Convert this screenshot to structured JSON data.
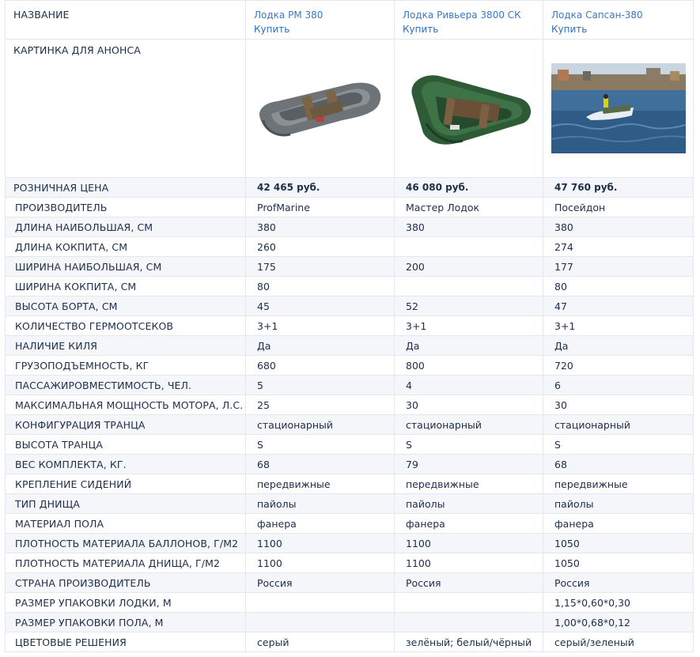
{
  "header_label": "НАЗВАНИЕ",
  "picture_label": "КАРТИНКА ДЛЯ АНОНСА",
  "price_label": "РОЗНИЧНАЯ ЦЕНА",
  "products": [
    {
      "name": "Лодка PM 380",
      "buy": "Купить",
      "price": "42 465 руб.",
      "image": "grey-inflatable-boat"
    },
    {
      "name": "Лодка Ривьера 3800 СК",
      "buy": "Купить",
      "price": "46 080 руб.",
      "image": "green-inflatable-boat"
    },
    {
      "name": "Лодка Сапсан-380",
      "buy": "Купить",
      "price": "47 760 руб.",
      "image": "boat-on-water-photo"
    }
  ],
  "specs": [
    {
      "label": "ПРОИЗВОДИТЕЛЬ",
      "values": [
        "ProfMarine",
        "Мастер Лодок",
        "Посейдон"
      ]
    },
    {
      "label": "ДЛИНА НАИБОЛЬШАЯ, СМ",
      "values": [
        "380",
        "380",
        "380"
      ]
    },
    {
      "label": "ДЛИНА КОКПИТА, СМ",
      "values": [
        "260",
        "",
        "274"
      ]
    },
    {
      "label": "ШИРИНА НАИБОЛЬШАЯ, СМ",
      "values": [
        "175",
        "200",
        "177"
      ]
    },
    {
      "label": "ШИРИНА КОКПИТА, СМ",
      "values": [
        "80",
        "",
        "80"
      ]
    },
    {
      "label": "ВЫСОТА БОРТА, СМ",
      "values": [
        "45",
        "52",
        "47"
      ]
    },
    {
      "label": "КОЛИЧЕСТВО ГЕРМООТСЕКОВ",
      "values": [
        "3+1",
        "3+1",
        "3+1"
      ]
    },
    {
      "label": "НАЛИЧИЕ КИЛЯ",
      "values": [
        "Да",
        "Да",
        "Да"
      ]
    },
    {
      "label": "ГРУЗОПОДЪЕМНОСТЬ, КГ",
      "values": [
        "680",
        "800",
        "720"
      ]
    },
    {
      "label": "ПАССАЖИРОВМЕСТИМОСТЬ, ЧЕЛ.",
      "values": [
        "5",
        "4",
        "6"
      ]
    },
    {
      "label": "МАКСИМАЛЬНАЯ МОЩНОСТЬ МОТОРА, Л.С.",
      "values": [
        "25",
        "30",
        "30"
      ]
    },
    {
      "label": "КОНФИГУРАЦИЯ ТРАНЦА",
      "values": [
        "стационарный",
        "стационарный",
        "стационарный"
      ]
    },
    {
      "label": "ВЫСОТА ТРАНЦА",
      "values": [
        "S",
        "S",
        "S"
      ]
    },
    {
      "label": "ВЕС КОМПЛЕКТА, КГ.",
      "values": [
        "68",
        "79",
        "68"
      ]
    },
    {
      "label": "КРЕПЛЕНИЕ СИДЕНИЙ",
      "values": [
        "передвижные",
        "передвижные",
        "передвижные"
      ]
    },
    {
      "label": "ТИП ДНИЩА",
      "values": [
        "пайолы",
        "пайолы",
        "пайолы"
      ]
    },
    {
      "label": "МАТЕРИАЛ ПОЛА",
      "values": [
        "фанера",
        "фанера",
        "фанера"
      ]
    },
    {
      "label": "ПЛОТНОСТЬ МАТЕРИАЛА БАЛЛОНОВ, Г/М2",
      "values": [
        "1100",
        "1100",
        "1050"
      ]
    },
    {
      "label": "ПЛОТНОСТЬ МАТЕРИАЛА ДНИЩА, Г/М2",
      "values": [
        "1100",
        "1100",
        "1050"
      ]
    },
    {
      "label": "СТРАНА ПРОИЗВОДИТЕЛЬ",
      "values": [
        "Россия",
        "Россия",
        "Россия"
      ]
    },
    {
      "label": "РАЗМЕР УПАКОВКИ ЛОДКИ, М",
      "values": [
        "",
        "",
        "1,15*0,60*0,30"
      ]
    },
    {
      "label": "РАЗМЕР УПАКОВКИ ПОЛА, М",
      "values": [
        "",
        "",
        "1,00*0,68*0,12"
      ]
    },
    {
      "label": "ЦВЕТОВЫЕ РЕШЕНИЯ",
      "values": [
        "серый",
        "зелёный; белый/чёрный",
        "серый/зеленый"
      ]
    }
  ]
}
